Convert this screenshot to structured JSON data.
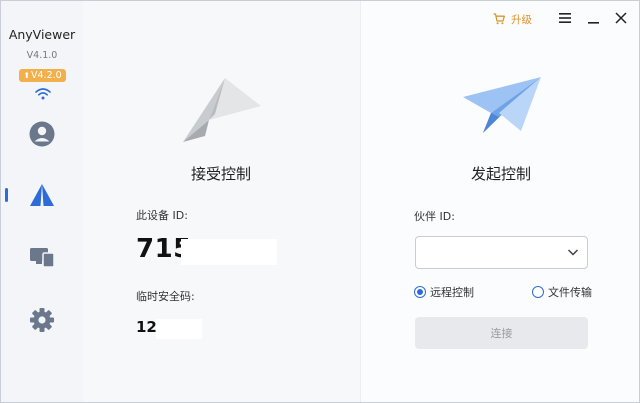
{
  "sidebar": {
    "app_name": "AnyViewer",
    "version": "V4.1.0",
    "update_badge": "V4.2.0",
    "nav": [
      {
        "icon": "user-icon"
      },
      {
        "icon": "remote-control-icon",
        "active": true
      },
      {
        "icon": "devices-icon"
      },
      {
        "icon": "settings-icon"
      }
    ]
  },
  "titlebar": {
    "upgrade_label": "升级",
    "upgrade_icon": "cart-icon",
    "menu_icon": "hamburger-icon",
    "minimize_icon": "minimize-icon",
    "close_icon": "close-icon"
  },
  "accept": {
    "title": "接受控制",
    "device_id_label": "此设备 ID:",
    "device_id": "715",
    "temp_code_label": "临时安全码:",
    "temp_code": "12"
  },
  "initiate": {
    "title": "发起控制",
    "partner_id_label": "伙伴 ID:",
    "partner_id_value": "",
    "radio_options": [
      {
        "label": "远程控制",
        "selected": true
      },
      {
        "label": "文件传输",
        "selected": false
      }
    ],
    "connect_label": "连接"
  },
  "colors": {
    "accent": "#2e6bd9",
    "upgrade": "#e0942a",
    "badge": "#f1b04a",
    "sidebar_icon": "#6b778b"
  }
}
